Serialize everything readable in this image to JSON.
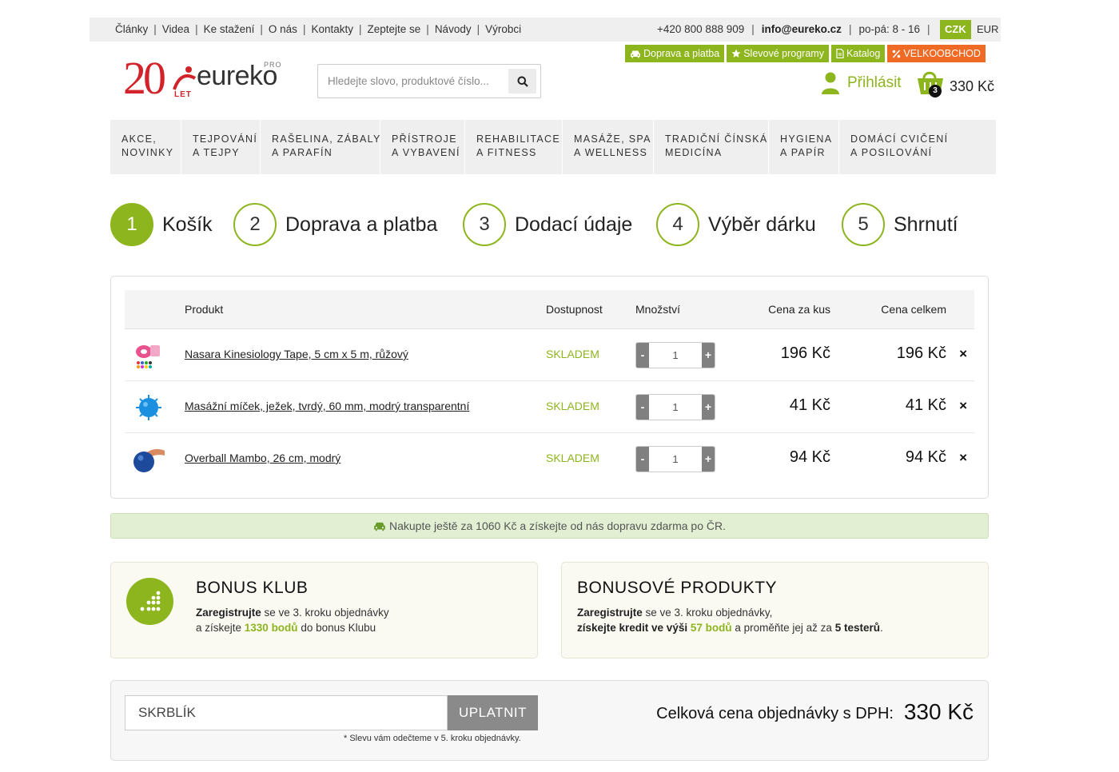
{
  "topbar": {
    "links": [
      "Články",
      "Videa",
      "Ke stažení",
      "O nás",
      "Kontakty",
      "Zeptejte se",
      "Návody",
      "Výrobci"
    ],
    "phone": "+420 800 888 909",
    "email": "info@eureko.cz",
    "hours": "po-pá: 8 - 16",
    "currency_active": "CZK",
    "currency_other": "EUR"
  },
  "quick_links": [
    {
      "label": "Doprava a platba",
      "icon": "car-icon"
    },
    {
      "label": "Slevové programy",
      "icon": "star-icon"
    },
    {
      "label": "Katalog",
      "icon": "document-icon"
    },
    {
      "label": "VELKOOBCHOD",
      "icon": "percent-icon"
    }
  ],
  "logo": {
    "years": "20",
    "years_sub": "LET",
    "name": "eureko",
    "sup": "PRO"
  },
  "search": {
    "placeholder": "Hledejte slovo, produktové číslo..."
  },
  "account": {
    "login_label": "Přihlásit"
  },
  "cart": {
    "count": "3",
    "total": "330 Kč"
  },
  "nav": [
    {
      "line1": "AKCE,",
      "line2": "NOVINKY"
    },
    {
      "line1": "TEJPOVÁNÍ",
      "line2": "A TEJPY"
    },
    {
      "line1": "RAŠELINA, ZÁBALY",
      "line2": "A PARAFÍN"
    },
    {
      "line1": "PŘÍSTROJE",
      "line2": "A VYBAVENÍ"
    },
    {
      "line1": "REHABILITACE",
      "line2": "A FITNESS"
    },
    {
      "line1": "MASÁŽE, SPA",
      "line2": "A WELLNESS"
    },
    {
      "line1": "TRADIČNÍ ČÍNSKÁ",
      "line2": "MEDICÍNA"
    },
    {
      "line1": "HYGIENA",
      "line2": "A PAPÍR"
    },
    {
      "line1": "DOMÁCÍ CVIČENÍ",
      "line2": "A POSILOVÁNÍ"
    }
  ],
  "steps": [
    {
      "num": "1",
      "label": "Košík"
    },
    {
      "num": "2",
      "label": "Doprava a platba"
    },
    {
      "num": "3",
      "label": "Dodací údaje"
    },
    {
      "num": "4",
      "label": "Výběr dárku"
    },
    {
      "num": "5",
      "label": "Shrnutí"
    }
  ],
  "table": {
    "headers": {
      "product": "Produkt",
      "availability": "Dostupnost",
      "quantity": "Množství",
      "unit_price": "Cena za kus",
      "total_price": "Cena celkem"
    },
    "rows": [
      {
        "name": "Nasara Kinesiology Tape, 5 cm x 5 m, růžový",
        "availability": "SKLADEM",
        "qty": "1",
        "unit": "196 Kč",
        "total": "196 Kč"
      },
      {
        "name": "Masážní míček, ježek, tvrdý, 60 mm, modrý transparentní",
        "availability": "SKLADEM",
        "qty": "1",
        "unit": "41 Kč",
        "total": "41 Kč"
      },
      {
        "name": "Overball Mambo, 26 cm, modrý",
        "availability": "SKLADEM",
        "qty": "1",
        "unit": "94 Kč",
        "total": "94 Kč"
      }
    ],
    "minus": "-",
    "plus": "+",
    "remove": "×"
  },
  "shipping_note": "Nakupte ještě za 1060 Kč a získejte od nás dopravu zdarma po ČR.",
  "bonus_club": {
    "title": "BONUS KLUB",
    "l1_bold": "Zaregistrujte",
    "l1_rest": " se ve 3. kroku objednávky",
    "l2_pre": "a získejte ",
    "l2_points": "1330 bodů",
    "l2_post": " do bonus Klubu"
  },
  "bonus_products": {
    "title": "BONUSOVÉ PRODUKTY",
    "l1_bold": "Zaregistrujte",
    "l1_rest": " se ve 3. kroku objednávky,",
    "l2_bold": "získejte kredit ve výši ",
    "l2_points": "57 bodů",
    "l2_mid": " a proměňte jej až za ",
    "l2_count": "5 testerů",
    "l2_end": "."
  },
  "summary": {
    "coupon_value": "SKRBLÍK",
    "apply_label": "UPLATNIT",
    "coupon_note": "* Slevu vám odečteme v 5. kroku objednávky.",
    "total_label": "Celková cena objednávky s DPH:",
    "total_value": "330 Kč"
  },
  "colors": {
    "accent": "#8db51d",
    "orange": "#ef6a25",
    "brand_red": "#d2232a"
  }
}
